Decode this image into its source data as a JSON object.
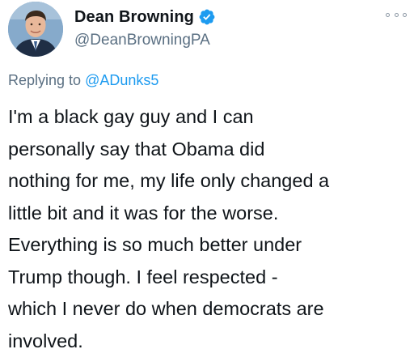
{
  "author": {
    "display_name": "Dean Browning",
    "handle": "@DeanBrowningPA",
    "verified_icon": "verified-badge-icon",
    "avatar_icon": "profile-photo"
  },
  "more_icon": "more-options-icon",
  "reply": {
    "prefix": "Replying to",
    "to_handle": "@ADunks5"
  },
  "body_lines": [
    "I'm a black gay guy and I can",
    "personally say that Obama did",
    "nothing for me, my life only changed a",
    "little bit and it was for the worse.",
    "Everything is so much better under",
    "Trump though. I feel respected -",
    "which I never do when democrats are",
    "involved."
  ],
  "colors": {
    "text": "#0f1419",
    "secondary": "#5b7083",
    "link": "#1d9bf0",
    "verified": "#1d9bf0"
  }
}
